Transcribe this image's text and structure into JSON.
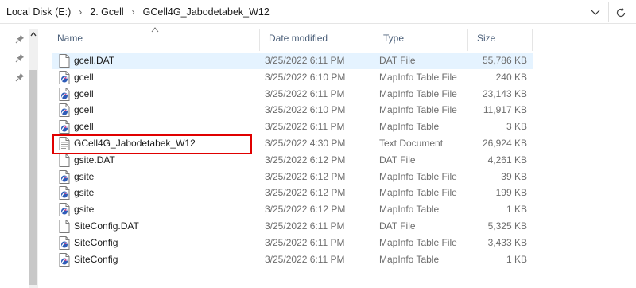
{
  "breadcrumb": [
    "Local Disk (E:)",
    "2. Gcell",
    "GCell4G_Jabodetabek_W12"
  ],
  "headers": {
    "name": "Name",
    "date": "Date modified",
    "type": "Type",
    "size": "Size"
  },
  "files": [
    {
      "name": "gcell.DAT",
      "date": "3/25/2022 6:11 PM",
      "type": "DAT File",
      "size": "55,786 KB",
      "icon": "file-icon",
      "selected": true
    },
    {
      "name": "gcell",
      "date": "3/25/2022 6:10 PM",
      "type": "MapInfo Table File",
      "size": "240 KB",
      "icon": "mapinfo-icon"
    },
    {
      "name": "gcell",
      "date": "3/25/2022 6:11 PM",
      "type": "MapInfo Table File",
      "size": "23,143 KB",
      "icon": "mapinfo-icon"
    },
    {
      "name": "gcell",
      "date": "3/25/2022 6:10 PM",
      "type": "MapInfo Table File",
      "size": "11,917 KB",
      "icon": "mapinfo-icon"
    },
    {
      "name": "gcell",
      "date": "3/25/2022 6:11 PM",
      "type": "MapInfo Table",
      "size": "3 KB",
      "icon": "mapinfo-icon"
    },
    {
      "name": "GCell4G_Jabodetabek_W12",
      "date": "3/25/2022 4:30 PM",
      "type": "Text Document",
      "size": "26,924 KB",
      "icon": "text-document-icon"
    },
    {
      "name": "gsite.DAT",
      "date": "3/25/2022 6:12 PM",
      "type": "DAT File",
      "size": "4,261 KB",
      "icon": "file-icon"
    },
    {
      "name": "gsite",
      "date": "3/25/2022 6:12 PM",
      "type": "MapInfo Table File",
      "size": "39 KB",
      "icon": "mapinfo-icon"
    },
    {
      "name": "gsite",
      "date": "3/25/2022 6:12 PM",
      "type": "MapInfo Table File",
      "size": "199 KB",
      "icon": "mapinfo-icon"
    },
    {
      "name": "gsite",
      "date": "3/25/2022 6:12 PM",
      "type": "MapInfo Table",
      "size": "1 KB",
      "icon": "mapinfo-icon"
    },
    {
      "name": "SiteConfig.DAT",
      "date": "3/25/2022 6:11 PM",
      "type": "DAT File",
      "size": "5,325 KB",
      "icon": "file-icon"
    },
    {
      "name": "SiteConfig",
      "date": "3/25/2022 6:11 PM",
      "type": "MapInfo Table File",
      "size": "3,433 KB",
      "icon": "mapinfo-icon"
    },
    {
      "name": "SiteConfig",
      "date": "3/25/2022 6:11 PM",
      "type": "MapInfo Table",
      "size": "1 KB",
      "icon": "mapinfo-icon"
    }
  ],
  "colors": {
    "selection": "#e5f3ff",
    "highlight_box": "#e00000",
    "header_text": "#4c607a"
  }
}
